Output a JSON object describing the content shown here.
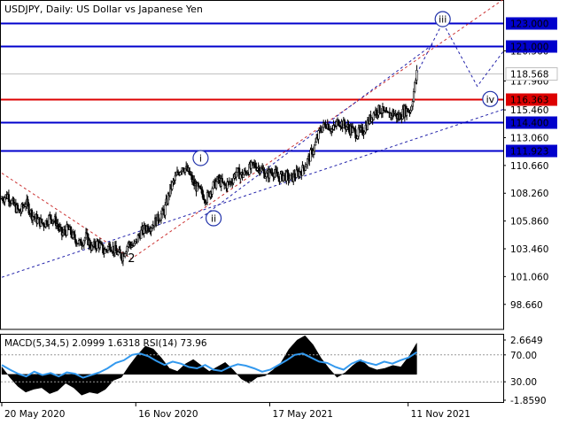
{
  "header": {
    "title": "USDJPY, Daily:  US Dollar vs Japanese Yen"
  },
  "macd_header": {
    "text": "MACD(5,34,5) 2.0999 1.6318 RSI(14) 73.96"
  },
  "colors": {
    "background": "#ffffff",
    "candles": "#000000",
    "level_blue": "#0000cc",
    "level_red": "#dd0000",
    "last_price_line": "#c0c0c0",
    "channel_red": "#cc3333",
    "channel_blue": "#2222aa",
    "wave_circle": "#2233aa",
    "macd_hist": "#000000",
    "signal_line": "#3399ee",
    "label_bg_blue": "#0000cc",
    "label_bg_red": "#dd0000"
  },
  "chart_data": [
    {
      "type": "line",
      "subtype": "candlestick-price-chart",
      "title": "USDJPY, Daily:  US Dollar vs Japanese Yen",
      "x_tick_labels": [
        "20 May 2020",
        "16 Nov 2020",
        "17 May 2021",
        "11 Nov 2021"
      ],
      "y_tick_labels": [
        "120.560",
        "117.960",
        "115.460",
        "113.060",
        "110.660",
        "108.260",
        "105.860",
        "103.460",
        "101.060",
        "98.660"
      ],
      "ylim": [
        96.5,
        124.8
      ],
      "grid": false,
      "current_price": {
        "value": 118.568,
        "label": "118.568"
      },
      "levels": [
        {
          "value": 123.0,
          "label": "123.000",
          "color": "blue"
        },
        {
          "value": 121.0,
          "label": "121.000",
          "color": "blue"
        },
        {
          "value": 116.363,
          "label": "116.363",
          "color": "red"
        },
        {
          "value": 114.4,
          "label": "114.400",
          "color": "blue"
        },
        {
          "value": 111.923,
          "label": "111.923",
          "color": "blue"
        }
      ],
      "wave_labels": [
        {
          "text": "2",
          "style": "plain",
          "x": 30,
          "y": 102.6
        },
        {
          "text": "i",
          "style": "circled",
          "x": 46,
          "y": 111.3
        },
        {
          "text": "ii",
          "style": "circled",
          "x": 49,
          "y": 106.1
        },
        {
          "text": "iii",
          "style": "circled",
          "x": 102,
          "y": 123.3
        },
        {
          "text": "iv",
          "style": "circled",
          "x": 113,
          "y": 116.4
        }
      ],
      "trendlines": [
        {
          "color": "red",
          "style": "dashed",
          "points": [
            [
              0,
              110.0
            ],
            [
              30,
              102.6
            ],
            [
              116,
              125.0
            ]
          ]
        },
        {
          "color": "blue",
          "style": "dashed",
          "points": [
            [
              0,
              101.0
            ],
            [
              116,
              115.5
            ]
          ]
        },
        {
          "color": "blue",
          "style": "dashed",
          "points": [
            [
              46,
              106.1
            ],
            [
              100,
              121.2
            ]
          ]
        },
        {
          "color": "blue",
          "style": "dashed",
          "points": [
            [
              96,
              118.6
            ],
            [
              102,
              123.0
            ],
            [
              110,
              117.5
            ],
            [
              116,
              120.5
            ]
          ]
        }
      ],
      "series": [
        {
          "name": "USDJPY weekly closes",
          "values": [
            107.8,
            108.1,
            107.2,
            106.6,
            107.5,
            106.4,
            105.9,
            105.6,
            106.2,
            105.8,
            104.7,
            105.2,
            104.4,
            103.9,
            104.5,
            103.5,
            104.0,
            103.2,
            103.8,
            103.2,
            102.8,
            103.9,
            103.7,
            104.8,
            105.3,
            105.5,
            106.1,
            106.7,
            108.6,
            109.7,
            110.6,
            110.1,
            109.0,
            108.4,
            107.8,
            108.8,
            109.4,
            108.9,
            109.2,
            110.1,
            109.8,
            110.3,
            110.7,
            110.4,
            109.8,
            110.2,
            109.6,
            109.8,
            109.5,
            109.9,
            110.3,
            111.2,
            112.3,
            113.8,
            114.3,
            113.7,
            114.5,
            114.1,
            113.8,
            113.4,
            113.6,
            114.5,
            115.3,
            115.5,
            114.9,
            115.2,
            114.8,
            115.4,
            115.5,
            118.6
          ]
        }
      ]
    },
    {
      "type": "bar",
      "subtype": "indicator-panel",
      "title": "MACD(5,34,5) 2.0999 1.6318 RSI(14) 73.96",
      "y_tick_labels": [
        "2.6649",
        "70.00",
        "30.00",
        "-1.8590"
      ],
      "ylim": [
        -1.859,
        2.6649
      ],
      "rsi_levels": [
        70,
        30
      ],
      "grid": false,
      "series": [
        {
          "name": "MACD",
          "values": [
            0.5,
            -0.2,
            -0.8,
            -1.2,
            -1.0,
            -0.9,
            -1.3,
            -1.1,
            -0.6,
            -0.9,
            -1.4,
            -1.2,
            -1.3,
            -1.0,
            -0.4,
            -0.2,
            0.6,
            1.3,
            1.9,
            1.7,
            1.1,
            0.4,
            0.2,
            0.7,
            1.0,
            0.6,
            0.2,
            0.5,
            0.8,
            0.3,
            -0.3,
            -0.6,
            -0.2,
            -0.1,
            0.3,
            0.8,
            1.7,
            2.3,
            2.6,
            2.0,
            1.1,
            0.4,
            -0.2,
            0.1,
            0.6,
            1.0,
            0.5,
            0.3,
            0.4,
            0.6,
            0.5,
            1.2,
            2.1
          ]
        },
        {
          "name": "RSI",
          "values": [
            55,
            48,
            42,
            38,
            45,
            40,
            43,
            38,
            44,
            42,
            36,
            40,
            44,
            50,
            58,
            62,
            70,
            72,
            68,
            61,
            55,
            60,
            57,
            52,
            50,
            55,
            48,
            46,
            52,
            56,
            54,
            50,
            45,
            48,
            55,
            62,
            70,
            72,
            66,
            60,
            58,
            52,
            48,
            57,
            62,
            58,
            55,
            60,
            57,
            62,
            66,
            74
          ]
        }
      ]
    }
  ]
}
